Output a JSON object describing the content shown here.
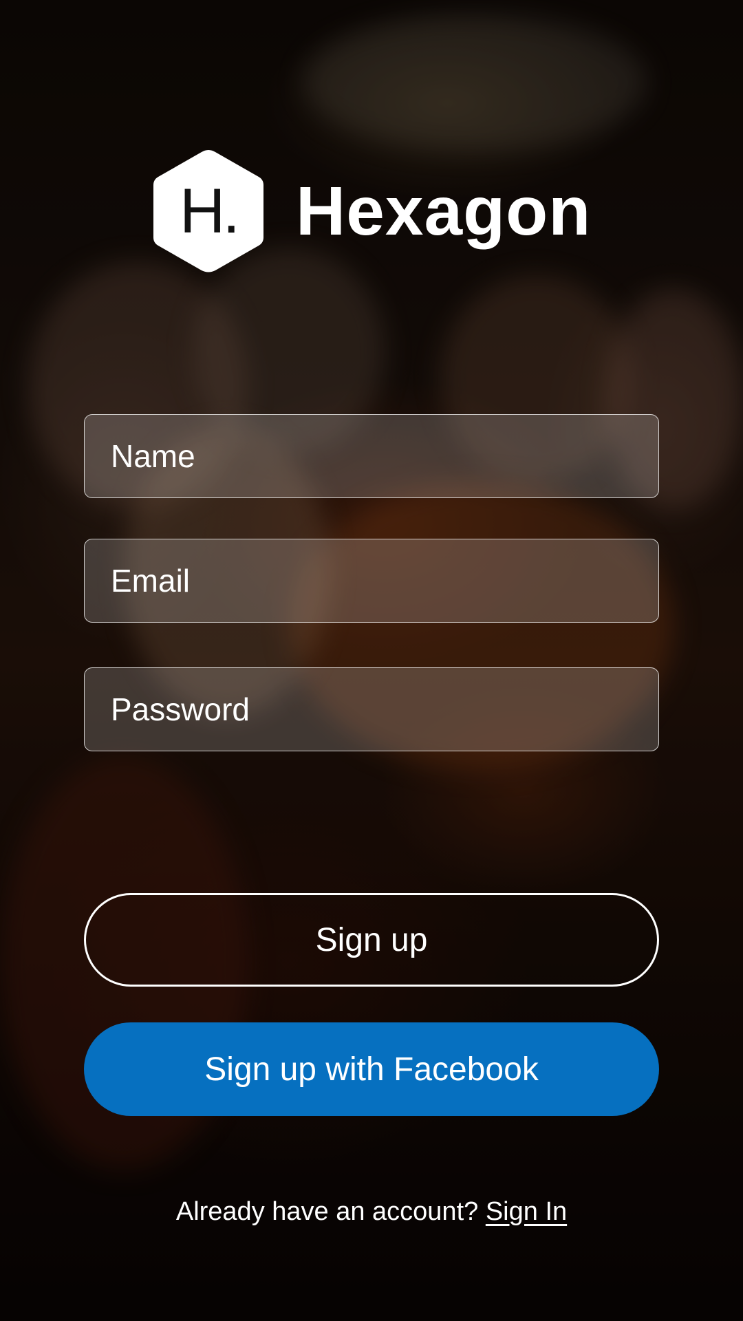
{
  "brand": {
    "logo_letter": "H.",
    "name": "Hexagon",
    "logo_icon": "hexagon-icon"
  },
  "form": {
    "name_placeholder": "Name",
    "email_placeholder": "Email",
    "password_placeholder": "Password"
  },
  "buttons": {
    "signup_label": "Sign up",
    "facebook_label": "Sign up with Facebook"
  },
  "footer": {
    "prompt": "Already have an account?",
    "signin_link": "Sign In"
  },
  "colors": {
    "facebook_button": "#0670c0",
    "text": "#ffffff"
  }
}
